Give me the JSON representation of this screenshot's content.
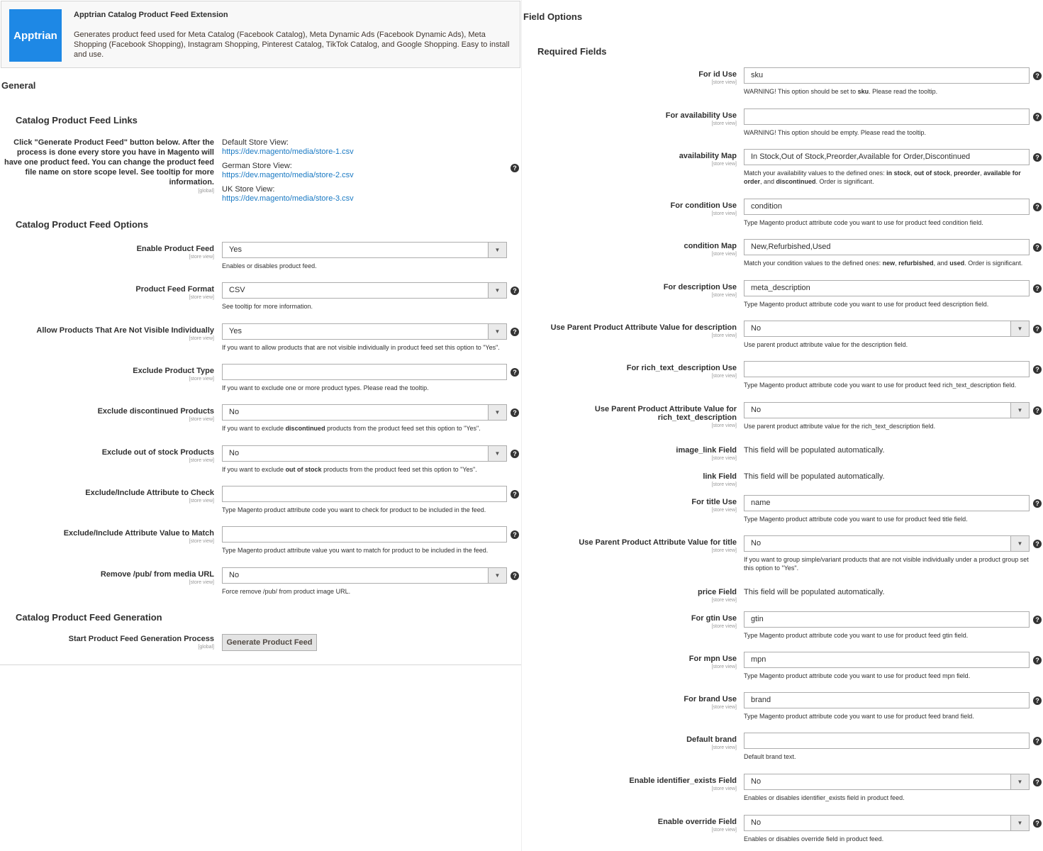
{
  "extension": {
    "logo_text": "Apptrian",
    "title": "Apptrian Catalog Product Feed Extension",
    "description": "Generates product feed used for Meta Catalog (Facebook Catalog), Meta Dynamic Ads (Facebook Dynamic Ads), Meta Shopping (Facebook Shopping), Instagram Shopping, Pinterest Catalog, TikTok Catalog, and Google Shopping. Easy to install and use."
  },
  "general": {
    "heading": "General",
    "links_section": {
      "heading": "Catalog Product Feed Links",
      "label": "Click \"Generate Product Feed\" button below. After the process is done every store you have in Magento will have one product feed. You can change the product feed file name on store scope level. See tooltip for more information.",
      "scope": "[global]",
      "stores": [
        {
          "name": "Default Store View:",
          "url": "https://dev.magento/media/store-1.csv"
        },
        {
          "name": "German Store View:",
          "url": "https://dev.magento/media/store-2.csv"
        },
        {
          "name": "UK Store View:",
          "url": "https://dev.magento/media/store-3.csv"
        }
      ]
    },
    "options_section": {
      "heading": "Catalog Product Feed Options",
      "fields": [
        {
          "label": "Enable Product Feed",
          "scope": "[store view]",
          "value": "Yes",
          "type": "select",
          "note": "Enables or disables product feed.",
          "help": false
        },
        {
          "label": "Product Feed Format",
          "scope": "[store view]",
          "value": "CSV",
          "type": "select",
          "note": "See tooltip for more information.",
          "help": true
        },
        {
          "label": "Allow Products That Are Not Visible Individually",
          "scope": "[store view]",
          "value": "Yes",
          "type": "select",
          "note": "If you want to allow products that are not visible individually in product feed set this option to \"Yes\".",
          "help": true
        },
        {
          "label": "Exclude Product Type",
          "scope": "[store view]",
          "value": "",
          "type": "text",
          "note": "If you want to exclude one or more product types. Please read the tooltip.",
          "help": true
        },
        {
          "label": "Exclude discontinued Products",
          "scope": "[store view]",
          "value": "No",
          "type": "select",
          "note_pre": "If you want to exclude ",
          "note_bold": "discontinued",
          "note_post": " products from the product feed set this option to \"Yes\".",
          "help": true
        },
        {
          "label": "Exclude out of stock Products",
          "scope": "[store view]",
          "value": "No",
          "type": "select",
          "note_pre": "If you want to exclude ",
          "note_bold": "out of stock",
          "note_post": " products from the product feed set this option to \"Yes\".",
          "help": true
        },
        {
          "label": "Exclude/Include Attribute to Check",
          "scope": "[store view]",
          "value": "",
          "type": "text",
          "note": "Type Magento product attribute code you want to check for product to be included in the feed.",
          "help": true
        },
        {
          "label": "Exclude/Include Attribute Value to Match",
          "scope": "[store view]",
          "value": "",
          "type": "text",
          "note": "Type Magento product attribute value you want to match for product to be included in the feed.",
          "help": true
        },
        {
          "label": "Remove /pub/ from media URL",
          "scope": "[store view]",
          "value": "No",
          "type": "select",
          "note": "Force remove /pub/ from product image URL.",
          "help": true
        }
      ]
    },
    "generation_section": {
      "heading": "Catalog Product Feed Generation",
      "label": "Start Product Feed Generation Process",
      "scope": "[global]",
      "button": "Generate Product Feed"
    }
  },
  "field_options": {
    "heading": "Field Options",
    "required_heading": "Required Fields",
    "fields": [
      {
        "label": "For id Use",
        "scope": "[store view]",
        "value": "sku",
        "type": "text",
        "note_pre": "WARNING! This option should be set to ",
        "note_bold": "sku",
        "note_post": ". Please read the tooltip."
      },
      {
        "label": "For availability Use",
        "scope": "[store view]",
        "value": "",
        "type": "text",
        "note": "WARNING! This option should be empty. Please read the tooltip."
      },
      {
        "label": "availability Map",
        "scope": "[store view]",
        "value": "In Stock,Out of Stock,Preorder,Available for Order,Discontinued",
        "type": "text",
        "note_html": "Match your availability values to the defined ones: <b>in stock</b>, <b>out of stock</b>, <b>preorder</b>, <b>available for order</b>, and <b>discontinued</b>. Order is significant."
      },
      {
        "label": "For condition Use",
        "scope": "[store view]",
        "value": "condition",
        "type": "text",
        "note": "Type Magento product attribute code you want to use for product feed condition field."
      },
      {
        "label": "condition Map",
        "scope": "[store view]",
        "value": "New,Refurbished,Used",
        "type": "text",
        "note_html": "Match your condition values to the defined ones: <b>new</b>, <b>refurbished</b>, and <b>used</b>. Order is significant."
      },
      {
        "label": "For description Use",
        "scope": "[store view]",
        "value": "meta_description",
        "type": "text",
        "note": "Type Magento product attribute code you want to use for product feed description field."
      },
      {
        "label": "Use Parent Product Attribute Value for description",
        "scope": "[store view]",
        "value": "No",
        "type": "select",
        "note": "Use parent product attribute value for the description field."
      },
      {
        "label": "For rich_text_description Use",
        "scope": "[store view]",
        "value": "",
        "type": "text",
        "note": "Type Magento product attribute code you want to use for product feed rich_text_description field."
      },
      {
        "label": "Use Parent Product Attribute Value for rich_text_description",
        "scope": "[store view]",
        "value": "No",
        "type": "select",
        "note": "Use parent product attribute value for the rich_text_description field."
      },
      {
        "label": "image_link Field",
        "scope": "[store view]",
        "value": "This field will be populated automatically.",
        "type": "plain"
      },
      {
        "label": "link Field",
        "scope": "[store view]",
        "value": "This field will be populated automatically.",
        "type": "plain"
      },
      {
        "label": "For title Use",
        "scope": "[store view]",
        "value": "name",
        "type": "text",
        "note": "Type Magento product attribute code you want to use for product feed title field."
      },
      {
        "label": "Use Parent Product Attribute Value for title",
        "scope": "[store view]",
        "value": "No",
        "type": "select",
        "note": "If you want to group simple/variant products that are not visible individually under a product group set this option to \"Yes\"."
      },
      {
        "label": "price Field",
        "scope": "[store view]",
        "value": "This field will be populated automatically.",
        "type": "plain"
      },
      {
        "label": "For gtin Use",
        "scope": "[store view]",
        "value": "gtin",
        "type": "text",
        "note": "Type Magento product attribute code you want to use for product feed gtin field."
      },
      {
        "label": "For mpn Use",
        "scope": "[store view]",
        "value": "mpn",
        "type": "text",
        "note": "Type Magento product attribute code you want to use for product feed mpn field."
      },
      {
        "label": "For brand Use",
        "scope": "[store view]",
        "value": "brand",
        "type": "text",
        "note": "Type Magento product attribute code you want to use for product feed brand field."
      },
      {
        "label": "Default brand",
        "scope": "[store view]",
        "value": "",
        "type": "text",
        "note": "Default brand text."
      },
      {
        "label": "Enable identifier_exists Field",
        "scope": "[store view]",
        "value": "No",
        "type": "select",
        "note": "Enables or disables identifier_exists field in product feed."
      },
      {
        "label": "Enable override Field",
        "scope": "[store view]",
        "value": "No",
        "type": "select",
        "note": "Enables or disables override field in product feed."
      }
    ]
  },
  "icons": {
    "help": "question-circle-icon",
    "caret": "chevron-down-icon"
  },
  "colors": {
    "link": "#1979c3",
    "logo_bg": "#1e88e5",
    "help_icon": "#333333"
  }
}
